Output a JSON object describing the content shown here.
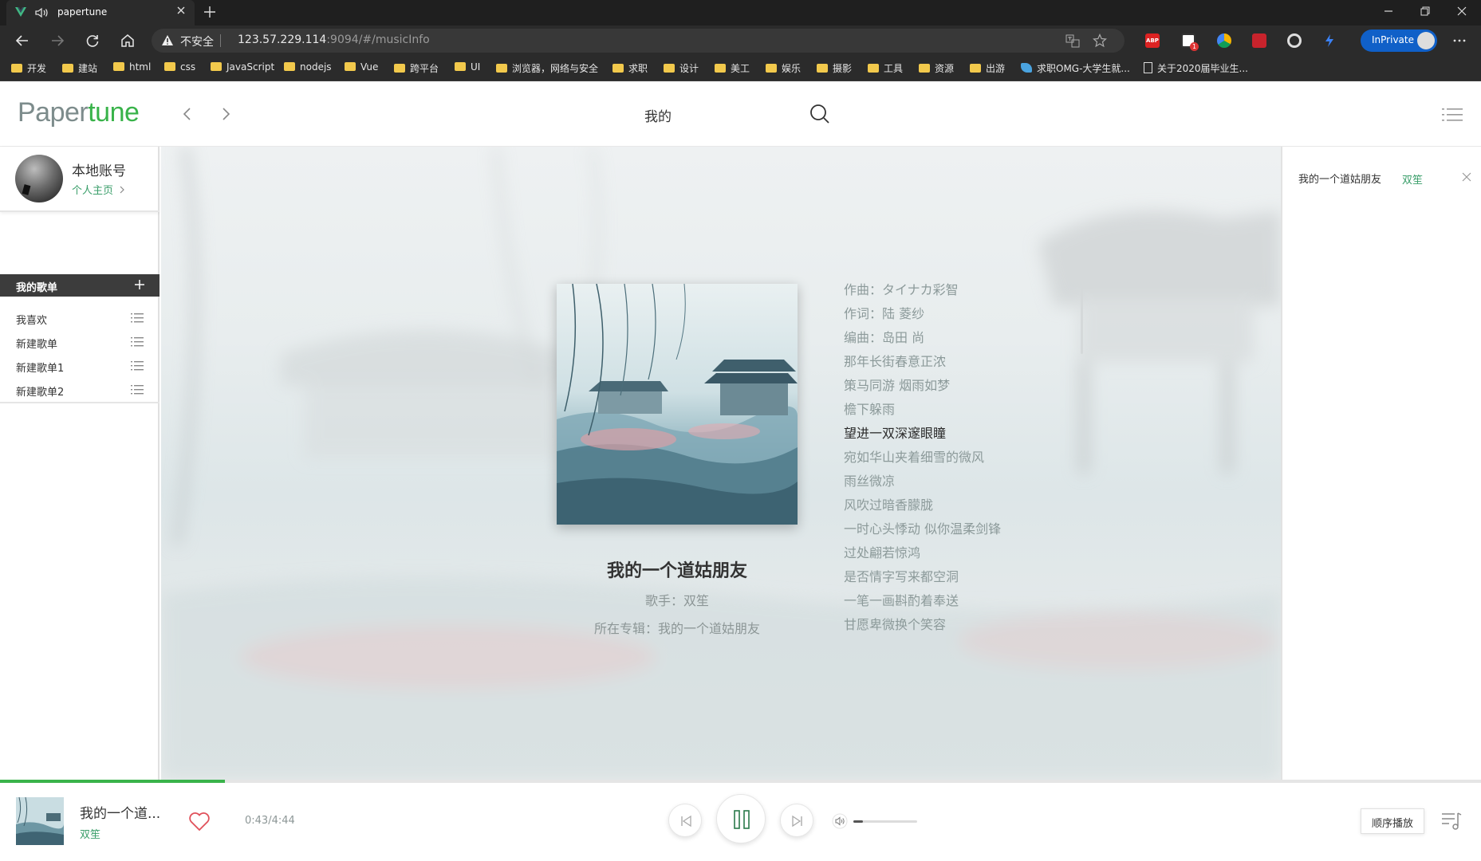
{
  "browser": {
    "tab_title": "papertune",
    "url_warning": "不安全",
    "url_host": "123.57.229.114",
    "url_path": ":9094/#/musicInfo",
    "inprivate_label": "InPrivate",
    "extension_badge": "1",
    "bookmarks": [
      {
        "label": "开发",
        "icon": "folder-icon"
      },
      {
        "label": "建站",
        "icon": "folder-icon"
      },
      {
        "label": "html",
        "icon": "folder-icon"
      },
      {
        "label": "css",
        "icon": "folder-icon"
      },
      {
        "label": "JavaScript",
        "icon": "folder-icon"
      },
      {
        "label": "nodejs",
        "icon": "folder-icon"
      },
      {
        "label": "Vue",
        "icon": "folder-icon"
      },
      {
        "label": "跨平台",
        "icon": "folder-icon"
      },
      {
        "label": "UI",
        "icon": "folder-icon"
      },
      {
        "label": "浏览器，网络与安全",
        "icon": "folder-icon"
      },
      {
        "label": "求职",
        "icon": "folder-icon"
      },
      {
        "label": "设计",
        "icon": "folder-icon"
      },
      {
        "label": "美工",
        "icon": "folder-icon"
      },
      {
        "label": "娱乐",
        "icon": "folder-icon"
      },
      {
        "label": "摄影",
        "icon": "folder-icon"
      },
      {
        "label": "工具",
        "icon": "folder-icon"
      },
      {
        "label": "资源",
        "icon": "folder-icon"
      },
      {
        "label": "出游",
        "icon": "folder-icon"
      },
      {
        "label": "求职OMG-大学生就...",
        "icon": "leaf-icon"
      },
      {
        "label": "关于2020届毕业生...",
        "icon": "page-icon"
      }
    ]
  },
  "app": {
    "logo_part1": "Paper",
    "logo_part2": "tune",
    "header_title": "我的",
    "brand_color": "#39b34a"
  },
  "sidebar": {
    "user_name": "本地账号",
    "user_link": "个人主页",
    "playlists_title": "我的歌单",
    "playlists": [
      {
        "label": "我喜欢"
      },
      {
        "label": "新建歌单"
      },
      {
        "label": "新建歌单1"
      },
      {
        "label": "新建歌单2"
      }
    ]
  },
  "song": {
    "title": "我的一个道姑朋友",
    "artist_line": "歌手：双笙",
    "album_line": "所在专辑：我的一个道姑朋友"
  },
  "lyrics": {
    "active_index": 6,
    "lines": [
      "作曲：タイナカ彩智",
      "作词：陆 菱纱",
      "编曲：岛田 尚",
      "那年长街春意正浓",
      "策马同游 烟雨如梦",
      "檐下躲雨",
      "望进一双深邃眼瞳",
      "宛如华山夹着细雪的微风",
      "雨丝微凉",
      "风吹过暗香朦胧",
      "一时心头悸动 似你温柔剑锋",
      "过处翩若惊鸿",
      "是否情字写来都空洞",
      "一笔一画斟酌着奉送",
      "甘愿卑微换个笑容"
    ]
  },
  "queue": {
    "items": [
      {
        "title": "我的一个道姑朋友",
        "artist": "双笙"
      }
    ]
  },
  "player": {
    "title": "我的一个道...",
    "artist": "双笙",
    "time": "0:43/4:44",
    "progress": 0.152,
    "volume": 0.15,
    "mode": "顺序播放"
  }
}
